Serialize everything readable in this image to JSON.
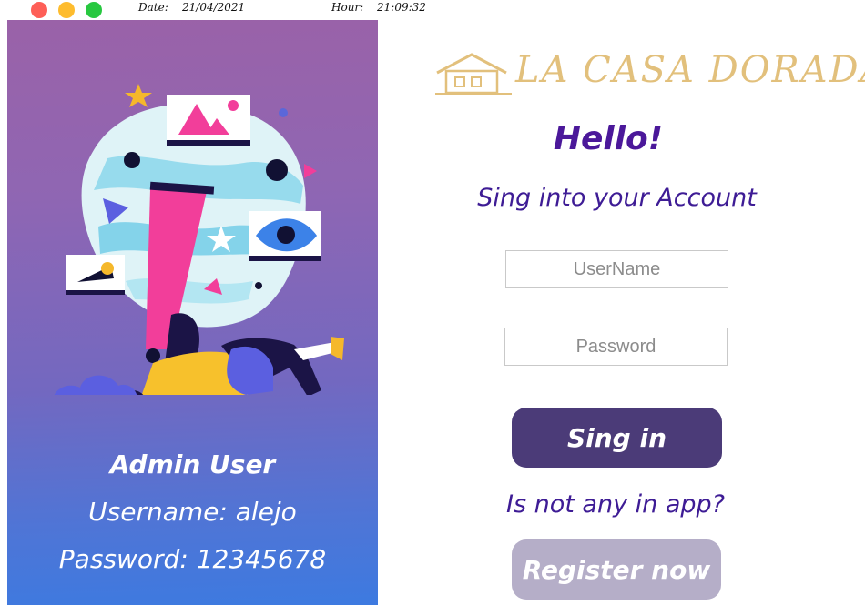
{
  "titlebar": {
    "date_label": "Date:",
    "date_value": "21/04/2021",
    "hour_label": "Hour:",
    "hour_value": "21:09:32"
  },
  "colors": {
    "close": "#fe5f57",
    "minimize": "#febc2e",
    "maximize": "#28c840",
    "accent_text": "#3e1c95",
    "signin_button": "#4b3b78",
    "register_button": "#b5aec8",
    "logo_gold": "#e2c07c"
  },
  "left_panel": {
    "illustration_icon": "person-with-art-frames-illustration",
    "admin_title": "Admin User",
    "username_text": "Username: alejo",
    "password_text": "Password: 12345678"
  },
  "right_panel": {
    "logo_text": "LA CASA DORADA",
    "logo_icon": "house-icon",
    "greeting": "Hello!",
    "subtitle": "Sing into your Account",
    "username_placeholder": "UserName",
    "username_value": "",
    "password_placeholder": "Password",
    "password_value": "",
    "signin_label": "Sing in",
    "register_question": "Is not any in app?",
    "register_label": "Register now"
  }
}
